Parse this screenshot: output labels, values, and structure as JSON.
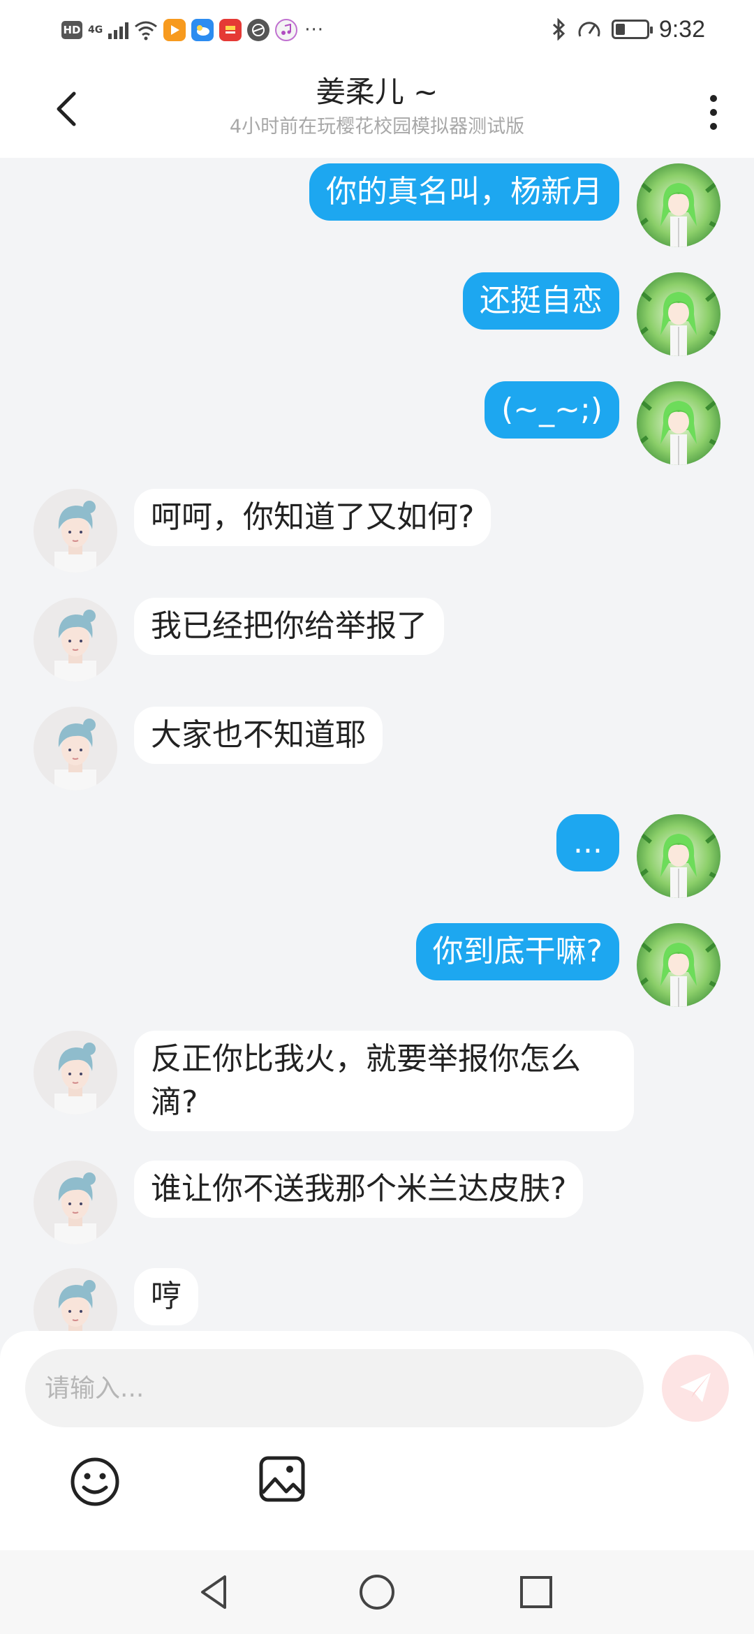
{
  "status_bar": {
    "hd": "HD",
    "network": "4G",
    "time": "9:32",
    "battery_level": 0.3,
    "more": "···"
  },
  "header": {
    "title": "姜柔儿 ~",
    "subtitle": "4小时前在玩樱花校园模拟器测试版"
  },
  "messages": [
    {
      "side": "out",
      "text": "你的真名叫，杨新月"
    },
    {
      "side": "out",
      "text": "还挺自恋"
    },
    {
      "side": "out",
      "text": "(~_~;)"
    },
    {
      "side": "in",
      "text": "呵呵，你知道了又如何?"
    },
    {
      "side": "in",
      "text": "我已经把你给举报了"
    },
    {
      "side": "in",
      "text": "大家也不知道耶"
    },
    {
      "side": "out",
      "text": "..."
    },
    {
      "side": "out",
      "text": "你到底干嘛?"
    },
    {
      "side": "in",
      "text": "反正你比我火，就要举报你怎么滴?"
    },
    {
      "side": "in",
      "text": "谁让你不送我那个米兰达皮肤?"
    },
    {
      "side": "in",
      "text": "哼"
    }
  ],
  "input": {
    "placeholder": "请输入...",
    "value": ""
  },
  "icons": {
    "back": "chevron-left-icon",
    "more": "more-vertical-icon",
    "send": "send-icon",
    "emoji": "emoji-icon",
    "image": "image-icon",
    "nav_back": "triangle-back-icon",
    "nav_home": "circle-home-icon",
    "nav_recent": "square-recent-icon"
  },
  "colors": {
    "outgoing_bubble": "#1da7f0",
    "incoming_bubble": "#ffffff",
    "background": "#f3f4f6",
    "send_button": "#fde4e4"
  }
}
